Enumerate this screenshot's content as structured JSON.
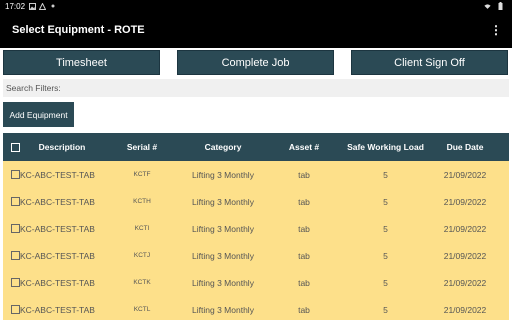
{
  "status_bar": {
    "time": "17:02"
  },
  "app_bar": {
    "title": "Select Equipment - ROTE",
    "overflow_label": "⋮"
  },
  "actions": {
    "timesheet": "Timesheet",
    "complete_job": "Complete Job",
    "client_sign_off": "Client Sign Off"
  },
  "filters": {
    "label": "Search Filters:"
  },
  "add_equipment": {
    "label": "Add Equipment"
  },
  "table": {
    "headers": {
      "description": "Description",
      "serial": "Serial #",
      "category": "Category",
      "asset": "Asset #",
      "swl": "Safe Working Load",
      "due_date": "Due Date"
    },
    "rows": [
      {
        "description": "KC-ABC-TEST-TAB",
        "serial": "KCTF",
        "category": "Lifting 3 Monthly",
        "asset": "tab",
        "swl": "5",
        "due_date": "21/09/2022"
      },
      {
        "description": "KC-ABC-TEST-TAB",
        "serial": "KCTH",
        "category": "Lifting 3 Monthly",
        "asset": "tab",
        "swl": "5",
        "due_date": "21/09/2022"
      },
      {
        "description": "KC-ABC-TEST-TAB",
        "serial": "KCTI",
        "category": "Lifting 3 Monthly",
        "asset": "tab",
        "swl": "5",
        "due_date": "21/09/2022"
      },
      {
        "description": "KC-ABC-TEST-TAB",
        "serial": "KCTJ",
        "category": "Lifting 3 Monthly",
        "asset": "tab",
        "swl": "5",
        "due_date": "21/09/2022"
      },
      {
        "description": "KC-ABC-TEST-TAB",
        "serial": "KCTK",
        "category": "Lifting 3 Monthly",
        "asset": "tab",
        "swl": "5",
        "due_date": "21/09/2022"
      },
      {
        "description": "KC-ABC-TEST-TAB",
        "serial": "KCTL",
        "category": "Lifting 3 Monthly",
        "asset": "tab",
        "swl": "5",
        "due_date": "21/09/2022"
      }
    ]
  },
  "colors": {
    "header_bg": "#2b4a55",
    "row_bg": "#fde08a",
    "app_bar_bg": "#000000"
  }
}
